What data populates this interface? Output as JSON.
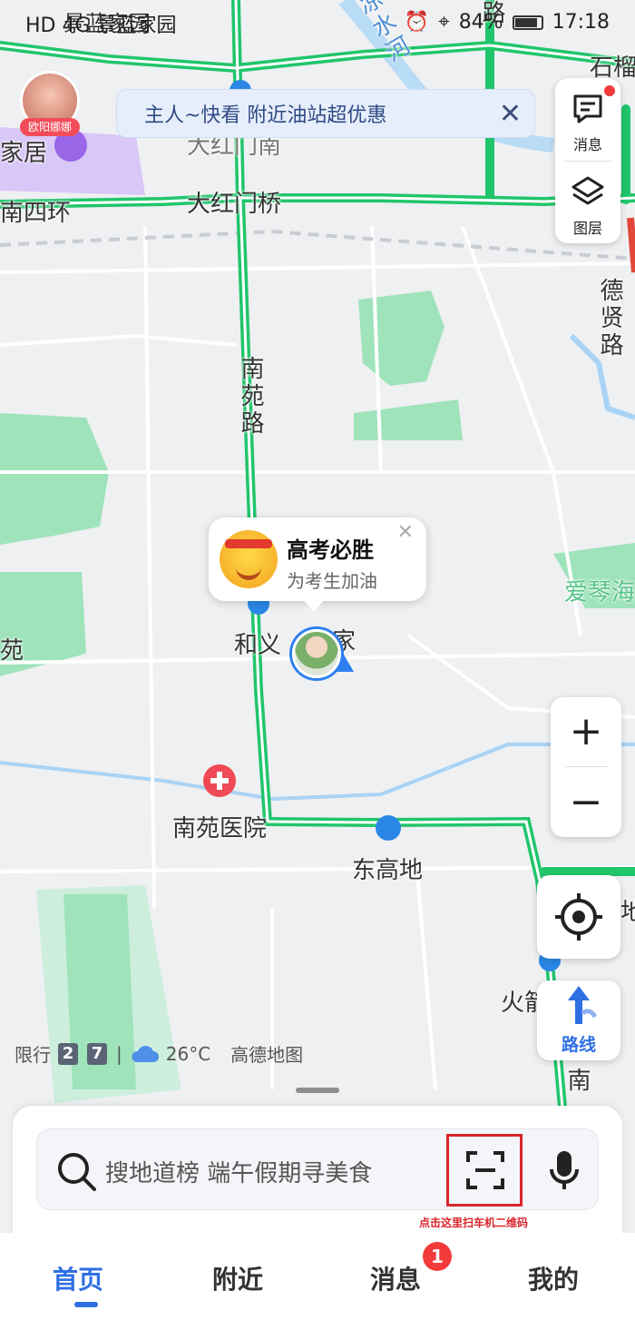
{
  "status_bar": {
    "left_text": "HD 4G 景蓝家园",
    "right_text": "84%",
    "time": "17:18"
  },
  "avatar_top": {
    "name": "欧阳娜娜"
  },
  "banner": {
    "text": "主人~快看 附近油站超优惠",
    "close_icon": "close-icon"
  },
  "side_panel": {
    "messages": {
      "label": "消息",
      "icon": "message-icon"
    },
    "layers": {
      "label": "图层",
      "icon": "layers-icon"
    }
  },
  "map": {
    "labels": [
      {
        "id": "jingxiu",
        "text": "景蓝家园"
      },
      {
        "id": "jiaju",
        "text": "家居"
      },
      {
        "id": "nansihuan",
        "text": "南四环"
      },
      {
        "id": "dahongmenqiao",
        "text": "大红门桥"
      },
      {
        "id": "dahongmennan",
        "text": "大红门南"
      },
      {
        "id": "nanyuanlu",
        "text": "南苑路"
      },
      {
        "id": "liangshuihe",
        "text": "凉水河"
      },
      {
        "id": "dexianlu",
        "text": "德贤路"
      },
      {
        "id": "heyi",
        "text": "和义"
      },
      {
        "id": "jia",
        "text": "家"
      },
      {
        "id": "aiqin",
        "text": "爱琴海"
      },
      {
        "id": "yuan",
        "text": "苑"
      },
      {
        "id": "nanyuanyiyuan",
        "text": "南苑医院"
      },
      {
        "id": "donggaodi",
        "text": "东高地"
      },
      {
        "id": "huo",
        "text": "火箭"
      },
      {
        "id": "nan",
        "text": "南"
      },
      {
        "id": "lu_top",
        "text": "路"
      },
      {
        "id": "liu",
        "text": "石榴"
      },
      {
        "id": "di",
        "text": "地"
      }
    ]
  },
  "popup": {
    "title": "高考必胜",
    "subtitle": "为考生加油"
  },
  "controls": {
    "zoom_in": "+",
    "zoom_out": "−",
    "route_label": "路线"
  },
  "info_bar": {
    "limit_label": "限行",
    "limit_digits": [
      "2",
      "7"
    ],
    "separator": "|",
    "temperature": "26°C",
    "brand": "高德地图"
  },
  "search": {
    "placeholder": "搜地道榜 端午假期寻美食",
    "scan_note": "点击这里扫车机二维码"
  },
  "tabs": [
    {
      "label": "首页",
      "active": true
    },
    {
      "label": "附近",
      "active": false
    },
    {
      "label": "消息",
      "active": false,
      "badge": "1"
    },
    {
      "label": "我的",
      "active": false
    }
  ]
}
